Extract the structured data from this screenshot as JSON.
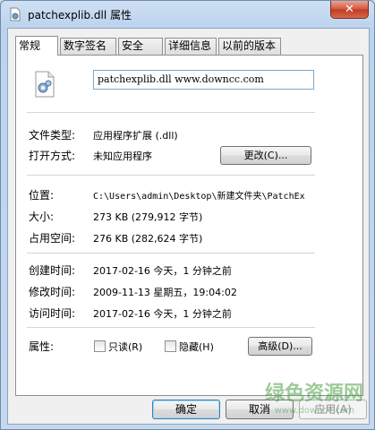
{
  "window": {
    "title": "patchexplib.dll 属性",
    "close_glyph": "✕"
  },
  "tabs": [
    {
      "label": "常规"
    },
    {
      "label": "数字签名"
    },
    {
      "label": "安全"
    },
    {
      "label": "详细信息"
    },
    {
      "label": "以前的版本"
    }
  ],
  "general": {
    "file_name": "patchexplib.dll www.downcc.com",
    "type_label": "文件类型:",
    "type_value": "应用程序扩展 (.dll)",
    "open_label": "打开方式:",
    "open_value": "未知应用程序",
    "change_button": "更改(C)...",
    "location_label": "位置:",
    "location_value": "C:\\Users\\admin\\Desktop\\新建文件夹\\PatchEx",
    "size_label": "大小:",
    "size_value": "273 KB (279,912 字节)",
    "size_on_disk_label": "占用空间:",
    "size_on_disk_value": "276 KB (282,624 字节)",
    "created_label": "创建时间:",
    "created_value": "2017-02-16 今天，1 分钟之前",
    "modified_label": "修改时间:",
    "modified_value": "2009-11-13 星期五，19:04:02",
    "accessed_label": "访问时间:",
    "accessed_value": "2017-02-16 今天，1 分钟之前",
    "attributes_label": "属性:",
    "readonly_label": "只读(R)",
    "hidden_label": "隐藏(H)",
    "advanced_button": "高级(D)..."
  },
  "footer": {
    "ok_button": "确定",
    "cancel_button": "取消",
    "apply_button": "应用(A)"
  },
  "watermark": {
    "main": "绿色资源网",
    "sub": "www.downcc.com"
  },
  "colors": {
    "accent": "#3c7fb1",
    "close": "#c23a20",
    "watermark": "#4da045"
  }
}
